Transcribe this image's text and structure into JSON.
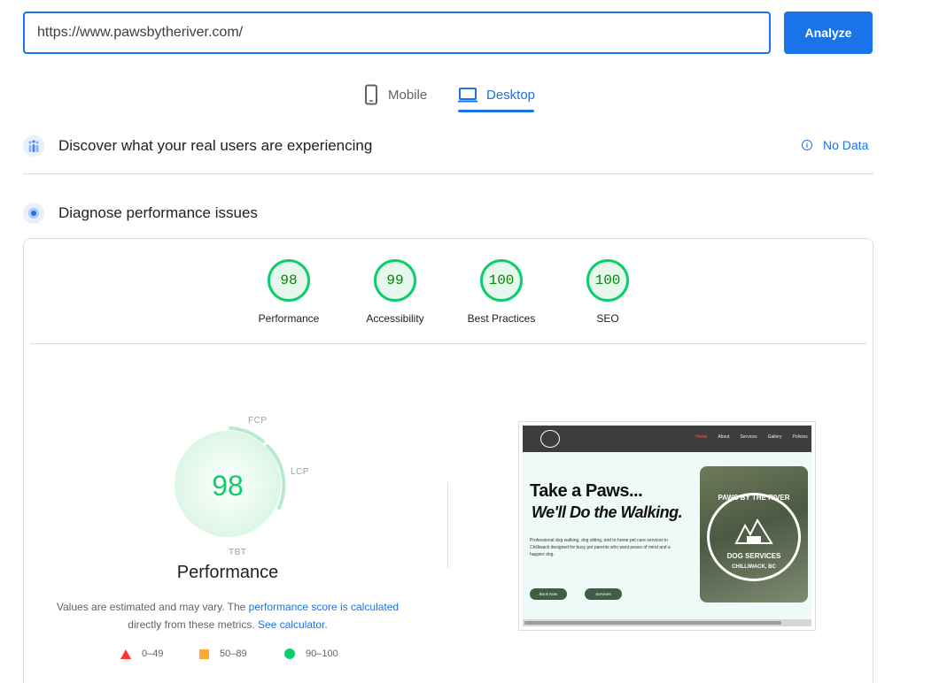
{
  "url_bar": {
    "value": "https://www.pawsbytheriver.com/",
    "analyze_label": "Analyze"
  },
  "device_tabs": {
    "mobile_label": "Mobile",
    "desktop_label": "Desktop",
    "selected": "Desktop"
  },
  "real_users": {
    "title": "Discover what your real users are experiencing",
    "status": "No Data"
  },
  "diagnose": {
    "title": "Diagnose performance issues"
  },
  "scores": [
    {
      "label": "Performance",
      "value": "98"
    },
    {
      "label": "Accessibility",
      "value": "99"
    },
    {
      "label": "Best Practices",
      "value": "100"
    },
    {
      "label": "SEO",
      "value": "100"
    }
  ],
  "performance": {
    "score": "98",
    "title": "Performance",
    "metric_labels": {
      "fcp": "FCP",
      "lcp": "LCP",
      "tbt": "TBT"
    },
    "note_prefix": "Values are estimated and may vary. The ",
    "note_link1": "performance score is calculated",
    "note_middle": " directly from these metrics.",
    "note_link2": "See calculator.",
    "legend": [
      {
        "range": "0–49",
        "color": "#ff3333"
      },
      {
        "range": "50–89",
        "color": "#ffaa33"
      },
      {
        "range": "90–100",
        "color": "#0cce6b"
      }
    ]
  },
  "thumbnail": {
    "nav_links": [
      "Home",
      "About",
      "Services",
      "Gallery",
      "Policies"
    ],
    "headline1": "Take a Paws...",
    "headline2": "We'll Do the Walking.",
    "paragraph": "Professional dog walking, dog sitting, and in-home pet care services in Chilliwack designed for busy pet parents who want peace of mind and a happier dog.",
    "button1": "Book Now",
    "button2": "Services",
    "badge_top": "PAWS BY THE RIVER",
    "badge_mid": "DOG SERVICES",
    "badge_bottom": "CHILLIWACK, BC"
  },
  "colors": {
    "accent": "#1a73e8",
    "pass": "#0cce6b",
    "average": "#ffaa33",
    "fail": "#ff3333"
  }
}
